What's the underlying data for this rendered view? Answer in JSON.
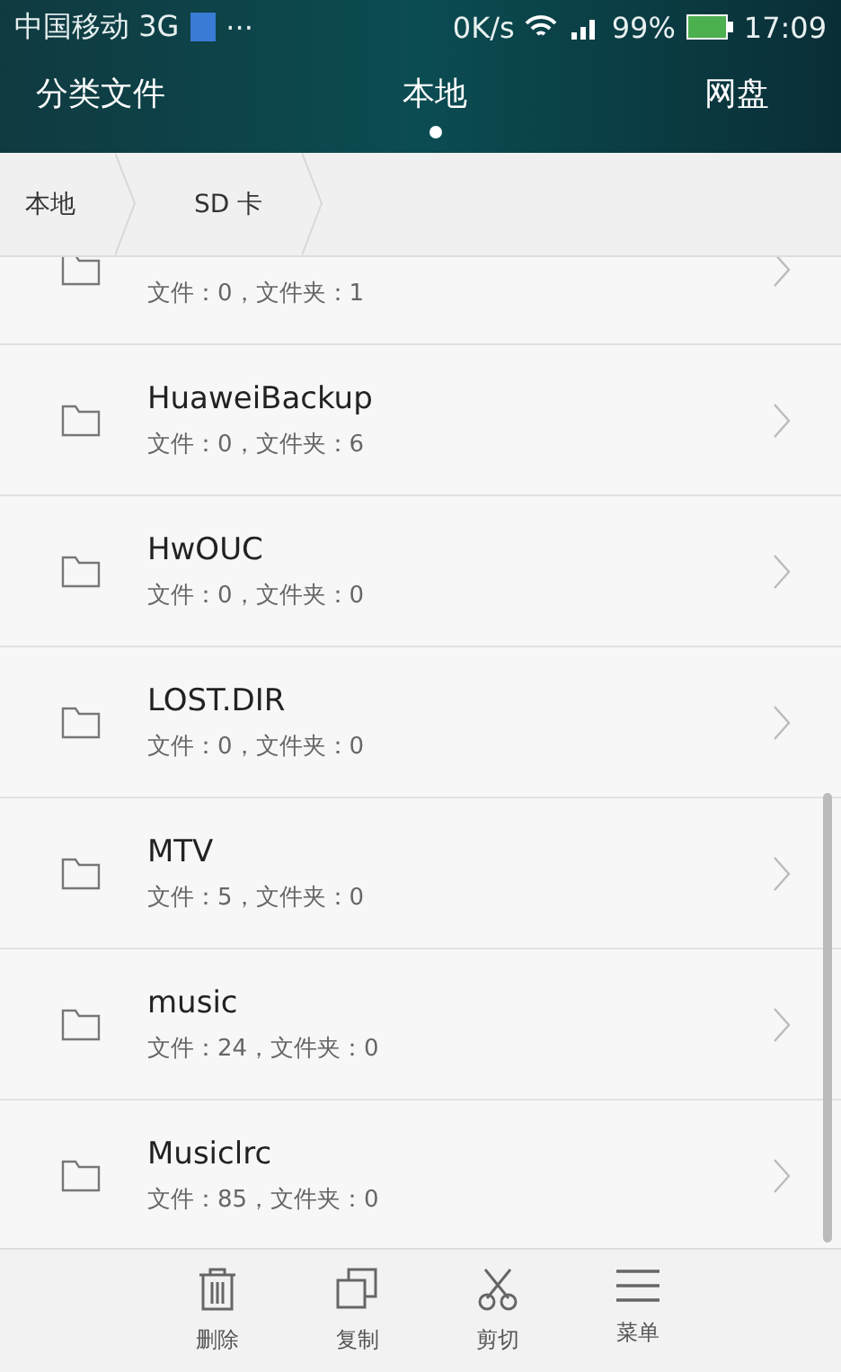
{
  "status_bar": {
    "carrier": "中国移动 3G",
    "more": "···",
    "speed": "0K/s",
    "battery": "99%",
    "time": "17:09"
  },
  "tabs": [
    {
      "label": "分类文件",
      "selected": false
    },
    {
      "label": "本地",
      "selected": true
    },
    {
      "label": "网盘",
      "selected": false
    }
  ],
  "breadcrumb": [
    "本地",
    "SD 卡"
  ],
  "folders": [
    {
      "info": "文件：0，文件夹：1"
    },
    {
      "name": "HuaweiBackup",
      "info": "文件：0，文件夹：6"
    },
    {
      "name": "HwOUC",
      "info": "文件：0，文件夹：0"
    },
    {
      "name": "LOST.DIR",
      "info": "文件：0，文件夹：0"
    },
    {
      "name": "MTV",
      "info": "文件：5，文件夹：0"
    },
    {
      "name": "music",
      "info": "文件：24，文件夹：0"
    },
    {
      "name": "Musiclrc",
      "info": "文件：85，文件夹：0"
    }
  ],
  "toolbar": [
    {
      "kind": "delete",
      "label": "删除"
    },
    {
      "kind": "copy",
      "label": "复制"
    },
    {
      "kind": "cut",
      "label": "剪切"
    },
    {
      "kind": "menu",
      "label": "菜单"
    }
  ]
}
